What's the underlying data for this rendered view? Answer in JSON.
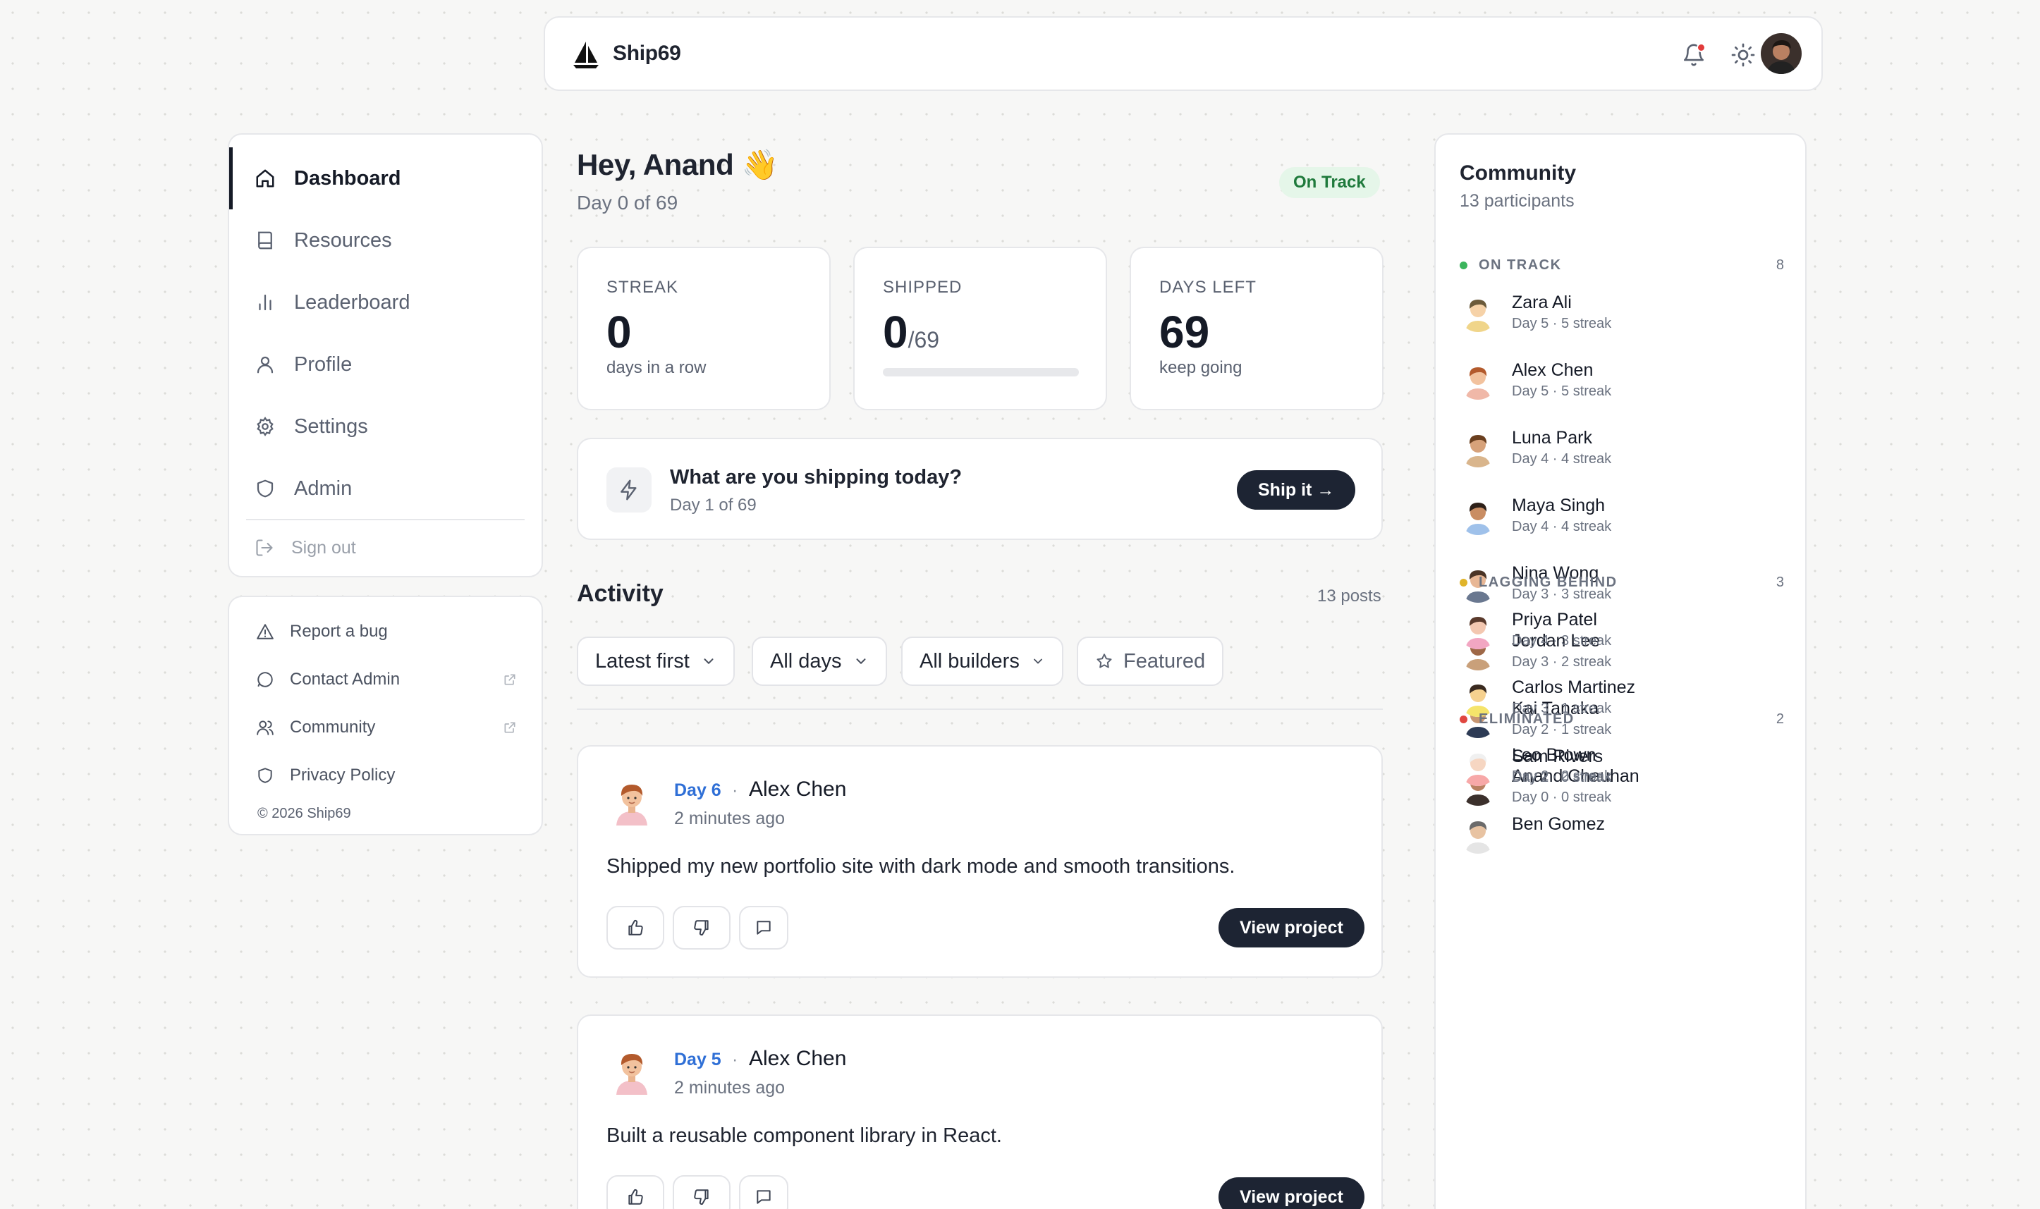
{
  "header": {
    "brand": "Ship69",
    "colors": {
      "notification_dot": "#e23b3b",
      "primary_dark": "#1d2433"
    }
  },
  "sidebar": {
    "items": [
      {
        "label": "Dashboard",
        "icon": "home-icon",
        "active": true
      },
      {
        "label": "Resources",
        "icon": "book-icon"
      },
      {
        "label": "Leaderboard",
        "icon": "bar-chart-icon"
      },
      {
        "label": "Profile",
        "icon": "user-icon"
      },
      {
        "label": "Settings",
        "icon": "gear-icon"
      },
      {
        "label": "Admin",
        "icon": "shield-icon"
      }
    ],
    "sign_out": "Sign out"
  },
  "links": {
    "items": [
      {
        "label": "Report a bug",
        "icon": "alert-triangle-icon"
      },
      {
        "label": "Contact Admin",
        "icon": "message-circle-icon",
        "external": true
      },
      {
        "label": "Community",
        "icon": "users-icon",
        "external": true
      },
      {
        "label": "Privacy Policy",
        "icon": "shield-icon"
      }
    ],
    "copyright": "© 2026 Ship69"
  },
  "main": {
    "greeting": "Hey, Anand 👋",
    "day_label": "Day 0 of 69",
    "status_badge": "On Track",
    "stats": {
      "streak": {
        "label": "STREAK",
        "value": "0",
        "sub": "days in a row"
      },
      "shipped": {
        "label": "SHIPPED",
        "value": "0",
        "total": "/69",
        "progress": 0
      },
      "days_left": {
        "label": "DAYS LEFT",
        "value": "69",
        "sub": "keep going"
      }
    },
    "ship_prompt": {
      "title": "What are you shipping today?",
      "sub": "Day 1 of 69",
      "button": "Ship it →"
    },
    "activity": {
      "title": "Activity",
      "count": "13 posts",
      "filters": {
        "sort": "Latest first",
        "days": "All days",
        "builders": "All builders",
        "featured": "Featured"
      },
      "posts": [
        {
          "day": "Day 6",
          "author": "Alex Chen",
          "time": "2 minutes ago",
          "body": "Shipped my new portfolio site with dark mode and smooth transitions.",
          "button": "View project"
        },
        {
          "day": "Day 5",
          "author": "Alex Chen",
          "time": "2 minutes ago",
          "body": "Built a reusable component library in React.",
          "button": "View project"
        }
      ]
    }
  },
  "community": {
    "title": "Community",
    "subtitle": "13 participants",
    "groups": [
      {
        "name": "ON TRACK",
        "count": "8",
        "color": "#3bb55c",
        "members": [
          {
            "name": "Zara Ali",
            "stat": "Day 5 · 5 streak"
          },
          {
            "name": "Alex Chen",
            "stat": "Day 5 · 5 streak"
          },
          {
            "name": "Luna Park",
            "stat": "Day 4 · 4 streak"
          },
          {
            "name": "Maya Singh",
            "stat": "Day 4 · 4 streak"
          },
          {
            "name": "Nina Wong",
            "stat": "Day 3 · 3 streak"
          },
          {
            "name": "Jordan Lee",
            "stat": "Day 3 · 2 streak"
          },
          {
            "name": "Kai Tanaka",
            "stat": "Day 2 · 1 streak"
          },
          {
            "name": "Anand Chauhan",
            "stat": "Day 0 · 0 streak"
          }
        ]
      },
      {
        "name": "LAGGING BEHIND",
        "count": "3",
        "color": "#e0b42a",
        "members": [
          {
            "name": "Priya Patel",
            "stat": "Day 4 · 3 streak"
          },
          {
            "name": "Carlos Martinez",
            "stat": "Day 3 · 1 streak"
          },
          {
            "name": "Leo Brown",
            "stat": "Day 2 · 2 streak"
          }
        ]
      },
      {
        "name": "ELIMINATED",
        "count": "2",
        "color": "#e0463f",
        "members": [
          {
            "name": "Sam Rivers",
            "stat": "Day 2 · 0 streak"
          },
          {
            "name": "Ben Gomez",
            "stat": ""
          }
        ]
      }
    ]
  }
}
